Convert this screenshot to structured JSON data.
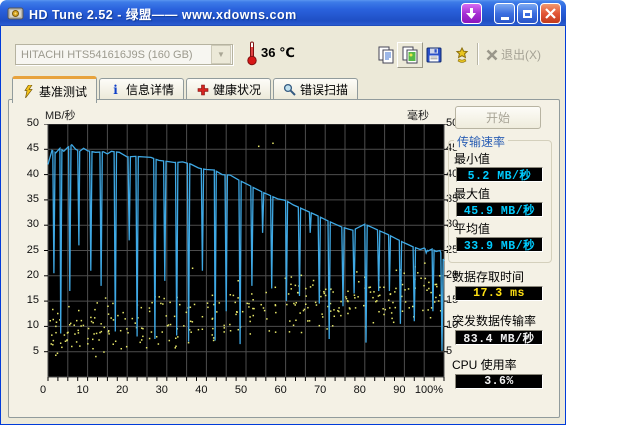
{
  "window": {
    "title": "HD Tune 2.52 - 绿盟—— www.xdowns.com"
  },
  "toolbar": {
    "drive_selector": {
      "value": "HITACHI HTS541616J9S (160 GB)"
    },
    "temperature": "36 ℃",
    "exit_label": "退出(X)"
  },
  "tabs": [
    {
      "label": "基准测试",
      "icon": "lightning-icon",
      "active": true
    },
    {
      "label": "信息详情",
      "icon": "info-icon",
      "active": false
    },
    {
      "label": "健康状况",
      "icon": "red-cross-icon",
      "active": false
    },
    {
      "label": "错误扫描",
      "icon": "magnifier-icon",
      "active": false
    }
  ],
  "icons": {
    "info_glyph": "i"
  },
  "panel": {
    "start_label": "开始",
    "group_title": "传输速率",
    "stats": [
      {
        "label": "最小值",
        "value": "5.2 MB/秒",
        "color": "#00CCFF"
      },
      {
        "label": "最大值",
        "value": "45.9 MB/秒",
        "color": "#00CCFF"
      },
      {
        "label": "平均值",
        "value": "33.9 MB/秒",
        "color": "#00CCFF"
      },
      {
        "label": "数据存取时间",
        "value": "17.3 ms",
        "color": "#FFE114"
      },
      {
        "label": "突发数据传输率",
        "value": "83.4 MB/秒",
        "color": "#F2F2F2"
      },
      {
        "label": "CPU 使用率",
        "value": "3.6%",
        "color": "#F2F2F2"
      }
    ]
  },
  "chart_data": {
    "type": "line",
    "title": "",
    "y_left_label": "MB/秒",
    "y_right_label": "毫秒",
    "y_range": [
      0,
      50
    ],
    "x_range_percent": [
      0,
      100
    ],
    "grid": true,
    "y_ticks": [
      50,
      45,
      40,
      35,
      30,
      25,
      20,
      15,
      10,
      5
    ],
    "x_ticks": [
      "0",
      "10",
      "20",
      "30",
      "40",
      "50",
      "60",
      "70",
      "80",
      "90",
      "100%"
    ],
    "colors": {
      "plot_bg": "#000000",
      "grid": "#4d4d4d",
      "transfer_line": "#3FA9E5",
      "access_dots": "#E8E86A"
    },
    "transfer_line": {
      "units": "MB/s read speed vs position %",
      "baseline": [
        [
          0,
          42
        ],
        [
          1,
          44.8
        ],
        [
          2,
          44.3
        ],
        [
          3,
          45.2
        ],
        [
          4,
          44.6
        ],
        [
          5,
          45.4
        ],
        [
          6,
          45.9
        ],
        [
          7,
          45
        ],
        [
          8,
          44.6
        ],
        [
          9,
          45.2
        ],
        [
          10,
          44.7
        ],
        [
          12,
          44.4
        ],
        [
          14,
          44.5
        ],
        [
          15,
          44.1
        ],
        [
          16,
          44.6
        ],
        [
          18,
          44.4
        ],
        [
          20,
          43.5
        ],
        [
          22,
          43.6
        ],
        [
          24,
          43.5
        ],
        [
          26,
          43.4
        ],
        [
          28,
          42.8
        ],
        [
          30,
          42.6
        ],
        [
          32,
          42.4
        ],
        [
          34,
          42.5
        ],
        [
          36,
          42.1
        ],
        [
          38,
          41.3
        ],
        [
          40,
          41
        ],
        [
          42,
          40.9
        ],
        [
          44,
          40
        ],
        [
          46,
          39.9
        ],
        [
          48,
          39
        ],
        [
          50,
          38.2
        ],
        [
          52,
          37.4
        ],
        [
          54,
          36.6
        ],
        [
          56,
          35.9
        ],
        [
          58,
          35.2
        ],
        [
          60,
          34.9
        ],
        [
          62,
          34
        ],
        [
          64,
          33.3
        ],
        [
          66,
          32.6
        ],
        [
          68,
          31.9
        ],
        [
          70,
          31.1
        ],
        [
          72,
          30.4
        ],
        [
          74,
          29.7
        ],
        [
          76,
          29.2
        ],
        [
          77,
          29
        ],
        [
          78,
          29.4
        ],
        [
          80,
          30.2
        ],
        [
          82,
          29.5
        ],
        [
          84,
          28.8
        ],
        [
          86,
          28.1
        ],
        [
          88,
          27.3
        ],
        [
          90,
          26.5
        ],
        [
          92,
          25.8
        ],
        [
          94,
          25.2
        ],
        [
          95,
          25.5
        ],
        [
          96,
          24.9
        ],
        [
          97,
          25.3
        ],
        [
          98,
          24.8
        ],
        [
          99,
          25
        ],
        [
          100,
          22.9
        ]
      ],
      "dips": [
        [
          1.5,
          20.5
        ],
        [
          3.2,
          8.6
        ],
        [
          5.5,
          17
        ],
        [
          7.8,
          26
        ],
        [
          10.8,
          21
        ],
        [
          13.4,
          18
        ],
        [
          17,
          9
        ],
        [
          20.5,
          27
        ],
        [
          22.5,
          8
        ],
        [
          27,
          7.5
        ],
        [
          29.5,
          19
        ],
        [
          32.5,
          8.2
        ],
        [
          35.5,
          7
        ],
        [
          39,
          21
        ],
        [
          42.2,
          7.2
        ],
        [
          45,
          13
        ],
        [
          48.5,
          6.5
        ],
        [
          51.5,
          18
        ],
        [
          54.2,
          28.5
        ],
        [
          56.5,
          17.5
        ],
        [
          60.2,
          15
        ],
        [
          63.5,
          16
        ],
        [
          66.2,
          28.5
        ],
        [
          68.5,
          14.5
        ],
        [
          71,
          7.5
        ],
        [
          74.5,
          14
        ],
        [
          77.3,
          16.5
        ],
        [
          80.3,
          6.8
        ],
        [
          83.5,
          17
        ],
        [
          86.2,
          17
        ],
        [
          89,
          10.5
        ],
        [
          92.5,
          11
        ],
        [
          95.5,
          24.5
        ],
        [
          97.2,
          13
        ],
        [
          99.5,
          5.2
        ]
      ]
    },
    "access_scatter": {
      "units": "access time ms vs position %",
      "count": 320,
      "x_span": [
        0.5,
        99.5
      ],
      "center_ms_start": 8.5,
      "center_ms_end": 17.5,
      "spread_ms": 6.5,
      "ms_min": 3,
      "ms_max": 25.5,
      "outliers": [
        [
          53.2,
          45.6
        ],
        [
          56.8,
          46.2
        ],
        [
          36.5,
          21.5
        ]
      ]
    },
    "summary": {
      "min_mbs": 5.2,
      "max_mbs": 45.9,
      "avg_mbs": 33.9,
      "access_ms": 17.3,
      "burst_mbs": 83.4,
      "cpu_pct": 3.6
    }
  }
}
